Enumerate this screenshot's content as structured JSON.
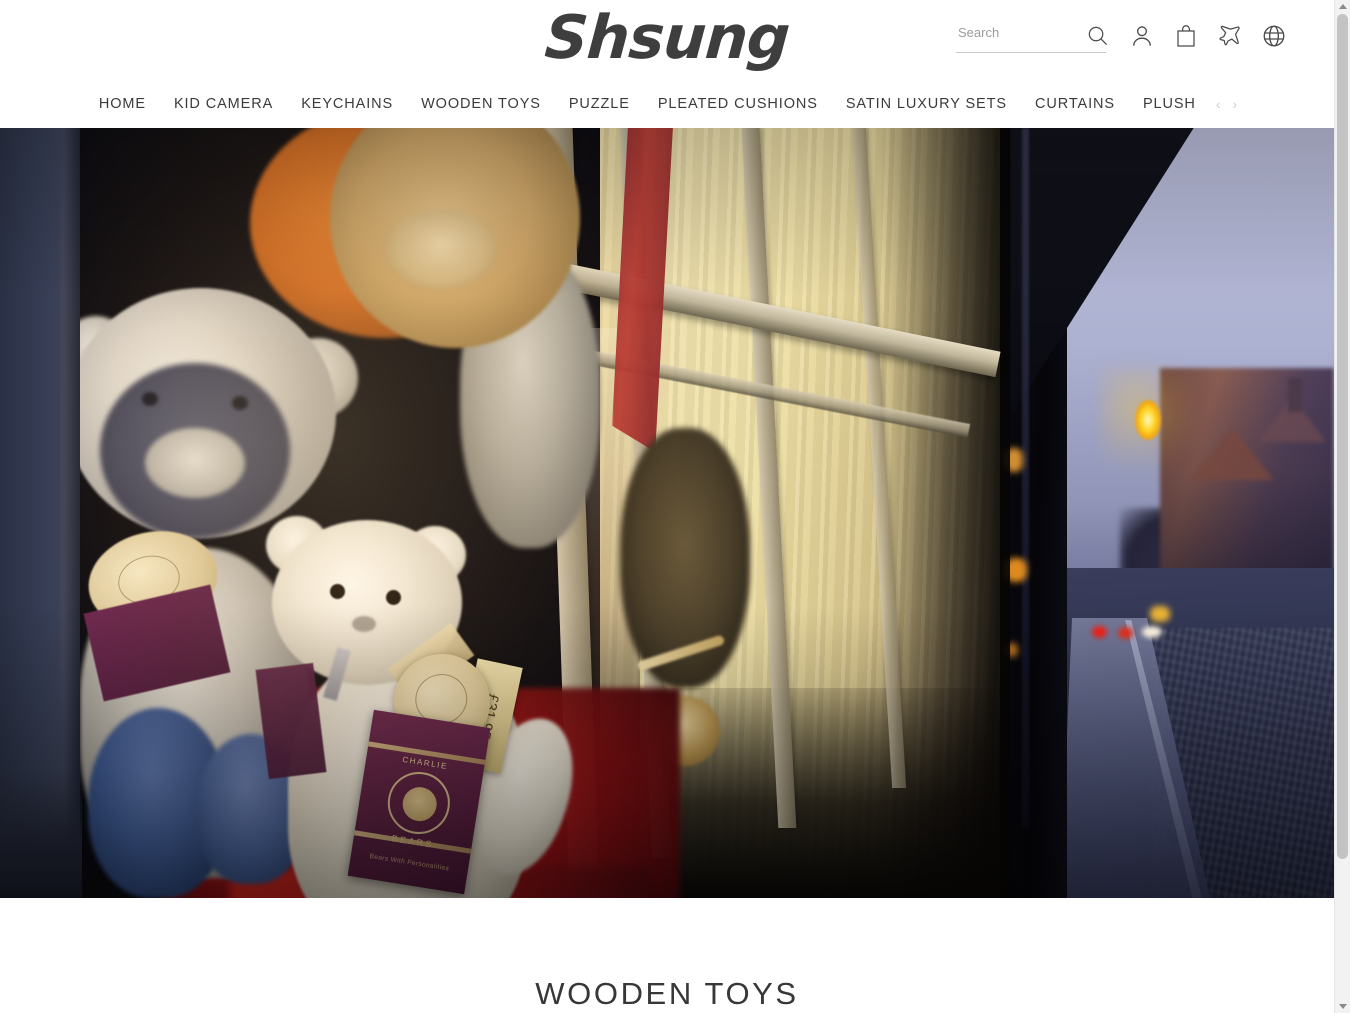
{
  "site": {
    "brand": "Shsung"
  },
  "header": {
    "search": {
      "placeholder": "Search",
      "value": ""
    },
    "icons": [
      {
        "name": "search-icon",
        "label": "Search"
      },
      {
        "name": "account-icon",
        "label": "Account"
      },
      {
        "name": "cart-icon",
        "label": "Cart"
      },
      {
        "name": "shipping-plane-icon",
        "label": "Shipping"
      },
      {
        "name": "language-globe-icon",
        "label": "Language"
      }
    ]
  },
  "nav": {
    "items": [
      {
        "label": "HOME"
      },
      {
        "label": "KID CAMERA"
      },
      {
        "label": "KEYCHAINS"
      },
      {
        "label": "WOODEN TOYS"
      },
      {
        "label": "PUZZLE"
      },
      {
        "label": "PLEATED CUSHIONS"
      },
      {
        "label": "SATIN LUXURY SETS"
      },
      {
        "label": "CURTAINS"
      },
      {
        "label": "PLUSH"
      }
    ],
    "prev_arrow": "‹",
    "next_arrow": "›"
  },
  "hero": {
    "alt": "Teddy bear shop window at dusk with plush bears and price tags",
    "tags": {
      "brand_top": "CHARLIE",
      "brand_bottom": "BEARS",
      "tagline": "Bears With Personalities",
      "price": "£31.95"
    }
  },
  "section": {
    "title": "WOODEN TOYS"
  },
  "scrollbar": {
    "up": "▲",
    "down": "▼"
  },
  "colors": {
    "text": "#3b3b3b",
    "muted": "#9b9b9b",
    "page_bg": "#ffffff",
    "scrollbar_thumb": "#c3c3c3"
  }
}
